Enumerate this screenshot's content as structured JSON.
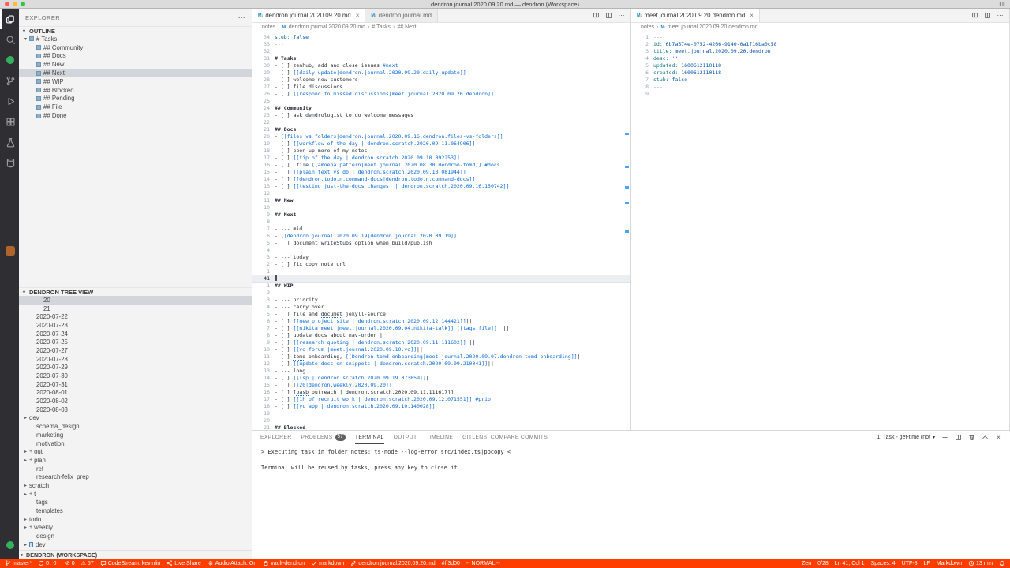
{
  "window": {
    "title": "dendron.journal.2020.09.20.md — dendron (Workspace)"
  },
  "colors": {
    "status_bar": "#ff3d00",
    "status_text": "#ffffff"
  },
  "activity_bar": {
    "items": [
      {
        "name": "explorer",
        "icon": "files",
        "active": true
      },
      {
        "name": "search",
        "icon": "search"
      },
      {
        "name": "live-share-contact",
        "style": "green-dot"
      },
      {
        "name": "source-control",
        "icon": "branch"
      },
      {
        "name": "run-and-debug",
        "icon": "debug"
      },
      {
        "name": "extensions",
        "icon": "extensions"
      },
      {
        "name": "testing",
        "icon": "flask"
      },
      {
        "name": "snippets",
        "icon": "database"
      },
      {
        "name": "codestream",
        "style": "orange-square",
        "gap": true
      },
      {
        "name": "account",
        "style": "green-dot",
        "bottom": true
      }
    ]
  },
  "sidebar": {
    "header": "EXPLORER",
    "outline": {
      "title": "OUTLINE",
      "items": [
        {
          "label": "# Tasks",
          "indent": 0,
          "expanded": true
        },
        {
          "label": "## Community",
          "indent": 1
        },
        {
          "label": "## Docs",
          "indent": 1
        },
        {
          "label": "## New",
          "indent": 1
        },
        {
          "label": "## Next",
          "indent": 1,
          "selected": true
        },
        {
          "label": "## WIP",
          "indent": 1
        },
        {
          "label": "## Blocked",
          "indent": 1
        },
        {
          "label": "## Pending",
          "indent": 1
        },
        {
          "label": "## File",
          "indent": 1
        },
        {
          "label": "## Done",
          "indent": 1
        }
      ]
    },
    "tree": {
      "title": "DENDRON TREE VIEW",
      "items": [
        {
          "label": "20",
          "indent": 2,
          "selected": true
        },
        {
          "label": "21",
          "indent": 2
        },
        {
          "label": "2020-07-22",
          "indent": 1
        },
        {
          "label": "2020-07-23",
          "indent": 1
        },
        {
          "label": "2020-07-24",
          "indent": 1
        },
        {
          "label": "2020-07-25",
          "indent": 1
        },
        {
          "label": "2020-07-27",
          "indent": 1
        },
        {
          "label": "2020-07-28",
          "indent": 1
        },
        {
          "label": "2020-07-29",
          "indent": 1
        },
        {
          "label": "2020-07-30",
          "indent": 1
        },
        {
          "label": "2020-07-31",
          "indent": 1
        },
        {
          "label": "2020-08-01",
          "indent": 1
        },
        {
          "label": "2020-08-02",
          "indent": 1
        },
        {
          "label": "2020-08-03",
          "indent": 1
        },
        {
          "label": "dev",
          "indent": 0,
          "chevron": true
        },
        {
          "label": "schema_design",
          "indent": 1
        },
        {
          "label": "marketing",
          "indent": 1
        },
        {
          "label": "motivation",
          "indent": 1
        },
        {
          "label": "out",
          "indent": 0,
          "chevron": true,
          "plus": true
        },
        {
          "label": "plan",
          "indent": 0,
          "chevron": true,
          "plus": true
        },
        {
          "label": "ref",
          "indent": 1
        },
        {
          "label": "research-felix_prep",
          "indent": 1
        },
        {
          "label": "scratch",
          "indent": 0,
          "chevron": true
        },
        {
          "label": "t",
          "indent": 0,
          "chevron": true,
          "plus": true
        },
        {
          "label": "tags",
          "indent": 1
        },
        {
          "label": "templates",
          "indent": 1
        },
        {
          "label": "todo",
          "indent": 0,
          "chevron": true
        },
        {
          "label": "weekly",
          "indent": 0,
          "chevron": true,
          "plus": true
        },
        {
          "label": "design",
          "indent": 1
        },
        {
          "label": "dev",
          "indent": 0,
          "chevron": true,
          "file_icon": true
        }
      ]
    },
    "workspace": "DENDRON (WORKSPACE)"
  },
  "editor_left": {
    "tabs": [
      {
        "label": "dendron.journal.2020.09.20.md",
        "active": true
      },
      {
        "label": "dendron.journal.md"
      }
    ],
    "breadcrumbs": [
      "notes",
      "dendron.journal.2020.09.20.md",
      "# Tasks",
      "## Next"
    ],
    "misspelled": [
      "zenhub",
      "documet",
      "tomd",
      "basb"
    ],
    "lines": [
      {
        "n": "34",
        "t": "stub: false",
        "k": "yaml"
      },
      {
        "n": "33",
        "t": "---",
        "k": "delim"
      },
      {
        "n": "32",
        "t": ""
      },
      {
        "n": "31",
        "t": "# Tasks",
        "k": "h"
      },
      {
        "n": "30",
        "t": "- [ ] zenhub, add and close issues #next"
      },
      {
        "n": "29",
        "t": "- [ ] [[daily update|dendron.journal.2020.09.20.daily-update]]"
      },
      {
        "n": "28",
        "t": "- [ ] welcome new customers"
      },
      {
        "n": "27",
        "t": "- [ ] file discussions"
      },
      {
        "n": "26",
        "t": "- [ ] [[respond to missed discussions|meet.journal.2020.09.20.dendron]]"
      },
      {
        "n": "25",
        "t": ""
      },
      {
        "n": "24",
        "t": "## Community",
        "k": "h"
      },
      {
        "n": "23",
        "t": "- [ ] ask dendrologist to do welcome messages"
      },
      {
        "n": "22",
        "t": ""
      },
      {
        "n": "21",
        "t": "## Docs",
        "k": "h"
      },
      {
        "n": "20",
        "t": "- [[files vs folders|dendron.journal.2020.09.16.dendron.files-vs-folders]]"
      },
      {
        "n": "19",
        "t": "- [ ] [[workflow of the day | dendron.scratch.2020.09.11.064906]]"
      },
      {
        "n": "18",
        "t": "- [ ] open up more of my notes"
      },
      {
        "n": "17",
        "t": "- [ ] [[tip of the day | dendron.scratch.2020.09.10.092253]]"
      },
      {
        "n": "16",
        "t": "- [ ]  file [[amoeba pattern|meet.journal.2020.08.30.dendron-tomd]] #docs"
      },
      {
        "n": "15",
        "t": "- [ ] [[plain text vs db | dendron.scratch.2020.09.13.081944]]"
      },
      {
        "n": "14",
        "t": "- [ ] [[dendron.todo.n.command-docs|dendron.todo.n.command-docs]]"
      },
      {
        "n": "13",
        "t": "- [ ] [[testing just-the-docs changes  | dendron.scratch.2020.09.16.150742]]"
      },
      {
        "n": "12",
        "t": ""
      },
      {
        "n": "11",
        "t": "## New",
        "k": "h"
      },
      {
        "n": "10",
        "t": ""
      },
      {
        "n": "9",
        "t": "## Next",
        "k": "h"
      },
      {
        "n": "8",
        "t": ""
      },
      {
        "n": "7",
        "t": "- --- mid"
      },
      {
        "n": "6",
        "t": "- [[dendron.journal.2020.09.19|dendron.journal.2020.09.19]]"
      },
      {
        "n": "5",
        "t": "- [ ] document writeStubs option when build/publish"
      },
      {
        "n": "4",
        "t": ""
      },
      {
        "n": "3",
        "t": "- --- today"
      },
      {
        "n": "2",
        "t": "- [ ] fix copy note url"
      },
      {
        "n": "1",
        "t": ""
      },
      {
        "n": "41",
        "t": "",
        "c": true
      },
      {
        "n": "1",
        "t": "## WIP",
        "k": "h"
      },
      {
        "n": "2",
        "t": ""
      },
      {
        "n": "3",
        "t": "- --- priority"
      },
      {
        "n": "4",
        "t": "- --- carry over"
      },
      {
        "n": "5",
        "t": "- [ ] file and documet jekyll-source"
      },
      {
        "n": "6",
        "t": "- [ ] [[new project site | dendron.scratch.2020.09.12.144421]]||"
      },
      {
        "n": "7",
        "t": "- [ ] [[nikita meet |meet.journal.2020.09.04.nikita-talk]] [[tags.file]]  |||"
      },
      {
        "n": "8",
        "t": "- [ ] update docs about nav-order |"
      },
      {
        "n": "9",
        "t": "- [ ] [[research quoting | dendron.scratch.2020.09.11.111602]] ||"
      },
      {
        "n": "10",
        "t": "- [ ] [[vo forum |meet.journal.2020.09.10.vo]]||"
      },
      {
        "n": "11",
        "t": "- [ ] tomd onboarding, [[Dendron-tomd-onboarding|meet.journal.2020.09.07.dendron-tomd-onboarding]]||"
      },
      {
        "n": "12",
        "t": "- [ ] [[update docs on snippets | dendron.scratch.2020.09.09.210041]]||"
      },
      {
        "n": "13",
        "t": "- --- long"
      },
      {
        "n": "14",
        "t": "- [ ] [[lsp | dendron.scratch.2020.09.19.073859]]|"
      },
      {
        "n": "15",
        "t": "- [ ] [[20|dendron.weekly.2020.09.20]]"
      },
      {
        "n": "16",
        "t": "- [ ] [basb outreach | dendron.scratch.2020.09.11.111617]]"
      },
      {
        "n": "17",
        "t": "- [ ] [[1h of recruit work | dendron.scratch.2020.09.12.071551]] #prio"
      },
      {
        "n": "18",
        "t": "- [ ] [[yc app | dendron.scratch.2020.09.10.140028]]"
      },
      {
        "n": "19",
        "t": ""
      },
      {
        "n": "20",
        "t": ""
      },
      {
        "n": "21",
        "t": "## Blocked",
        "k": "h"
      }
    ]
  },
  "editor_right": {
    "tabs": [
      {
        "label": "meet.journal.2020.09.20.dendron.md",
        "active": true
      }
    ],
    "breadcrumbs": [
      "notes",
      "meet.journal.2020.09.20.dendron.md"
    ],
    "misspelled": [],
    "lines": [
      {
        "n": "1",
        "t": "---",
        "k": "delim"
      },
      {
        "n": "2",
        "t": "id: 6b7a574e-0752-4266-9140-0a1f16ba0c58",
        "k": "yaml"
      },
      {
        "n": "3",
        "t": "title: meet.journal.2020.09.20.dendron",
        "k": "yaml"
      },
      {
        "n": "4",
        "t": "desc: ''",
        "k": "yaml"
      },
      {
        "n": "5",
        "t": "updated: 1600612110118",
        "k": "yaml"
      },
      {
        "n": "6",
        "t": "created: 1600612110118",
        "k": "yaml"
      },
      {
        "n": "7",
        "t": "stub: false",
        "k": "yaml"
      },
      {
        "n": "8",
        "t": "---",
        "k": "delim"
      },
      {
        "n": "9",
        "t": ""
      }
    ]
  },
  "panel": {
    "tabs": [
      {
        "label": "EXPLORER"
      },
      {
        "label": "PROBLEMS",
        "badge": "57"
      },
      {
        "label": "TERMINAL",
        "active": true
      },
      {
        "label": "OUTPUT"
      },
      {
        "label": "TIMELINE"
      },
      {
        "label": "GITLENS: COMPARE COMMITS"
      }
    ],
    "terminal_picker": "1: Task - get-time (not",
    "terminal_lines": [
      "> Executing task in folder notes: ts-node --log-error src/index.ts|pbcopy <",
      "",
      "Terminal will be reused by tasks, press any key to close it."
    ]
  },
  "status_bar": {
    "left": [
      {
        "name": "git-branch",
        "icon": "branch",
        "label": "master*"
      },
      {
        "name": "git-sync",
        "icon": "sync",
        "label": "0↓ 0↑"
      },
      {
        "name": "problems-errors",
        "glyph": "⊘",
        "label": "0"
      },
      {
        "name": "problems-warnings",
        "glyph": "⚠",
        "label": "57"
      },
      {
        "name": "codestream",
        "icon": "comment",
        "label": "CodeStream: kevinlin"
      },
      {
        "name": "live-share",
        "icon": "share",
        "label": "Live Share"
      },
      {
        "name": "audio-attach",
        "icon": "mic",
        "label": "Audio Attach: On"
      },
      {
        "name": "vault",
        "icon": "lock",
        "label": "vault-dendron"
      },
      {
        "name": "markdown-lint",
        "icon": "check",
        "label": "markdown"
      },
      {
        "name": "current-file",
        "icon": "pencil",
        "label": "dendron.journal.2020.09.20.md"
      },
      {
        "name": "color-hex",
        "label": "#ff3d00"
      },
      {
        "name": "vim-mode",
        "label": "-- NORMAL --"
      }
    ],
    "right": [
      {
        "name": "zen",
        "label": "Zen"
      },
      {
        "name": "spell-count",
        "label": "0/28"
      },
      {
        "name": "cursor-position",
        "label": "Ln 41, Col 1"
      },
      {
        "name": "indentation",
        "label": "Spaces: 4"
      },
      {
        "name": "encoding",
        "label": "UTF-8"
      },
      {
        "name": "eol",
        "label": "LF"
      },
      {
        "name": "language-mode",
        "label": "Markdown"
      },
      {
        "name": "tracked-time",
        "icon": "clock",
        "label": "13 min"
      },
      {
        "name": "notifications",
        "icon": "bell",
        "label": ""
      }
    ]
  }
}
